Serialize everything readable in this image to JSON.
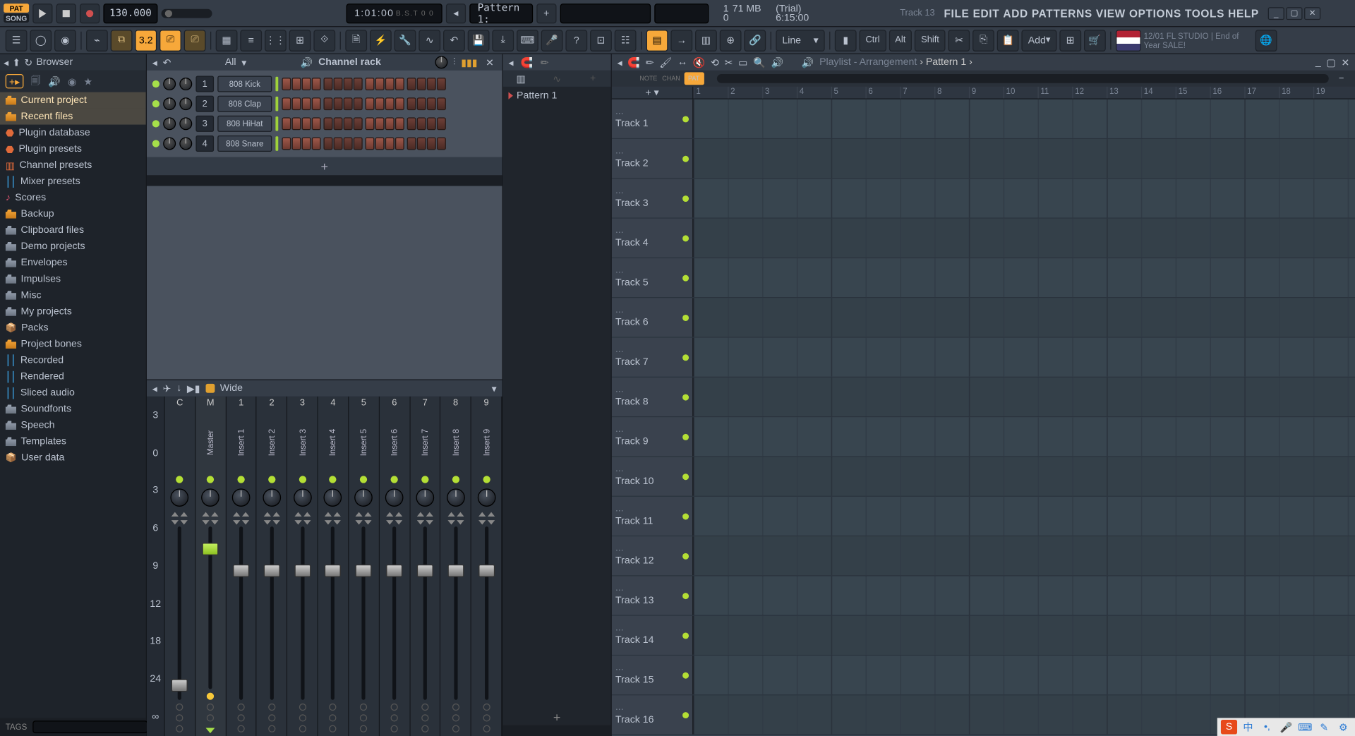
{
  "transport": {
    "patSong": {
      "pat": "PAT",
      "song": "SONG"
    },
    "tempo": "130.000",
    "time": "1:01:00",
    "timeSuffix": "B.S.T\n0 0",
    "patternSelector": "Pattern 1:",
    "cpu": "1",
    "cpuUnit": "",
    "mem": "71 MB",
    "mem2": "0",
    "trial": "(Trial)",
    "clock": "6:15:00",
    "trackHint": "Track 13",
    "news": "12/01  FL STUDIO | End of Year SALE!"
  },
  "menu": [
    "FILE",
    "EDIT",
    "ADD",
    "PATTERNS",
    "VIEW",
    "OPTIONS",
    "TOOLS",
    "HELP"
  ],
  "toolbar2": {
    "snap": "Line",
    "mods": [
      "Ctrl",
      "Alt",
      "Shift"
    ],
    "add": "Add",
    "numbered": "3.2"
  },
  "browser": {
    "title": "Browser",
    "items": [
      {
        "label": "Current project",
        "type": "hl"
      },
      {
        "label": "Recent files",
        "type": "hl"
      },
      {
        "label": "Plugin database",
        "icon": "plugin"
      },
      {
        "label": "Plugin presets",
        "icon": "plugin"
      },
      {
        "label": "Channel presets",
        "icon": "channel"
      },
      {
        "label": "Mixer presets",
        "icon": "mixer"
      },
      {
        "label": "Scores",
        "icon": "wave"
      },
      {
        "label": "Backup",
        "icon": "folderO"
      },
      {
        "label": "Clipboard files",
        "icon": "folder"
      },
      {
        "label": "Demo projects",
        "icon": "folder"
      },
      {
        "label": "Envelopes",
        "icon": "folder"
      },
      {
        "label": "Impulses",
        "icon": "folder"
      },
      {
        "label": "Misc",
        "icon": "folder"
      },
      {
        "label": "My projects",
        "icon": "folder"
      },
      {
        "label": "Packs",
        "icon": "packs"
      },
      {
        "label": "Project bones",
        "icon": "folderO"
      },
      {
        "label": "Recorded",
        "icon": "mixer"
      },
      {
        "label": "Rendered",
        "icon": "mixer"
      },
      {
        "label": "Sliced audio",
        "icon": "mixer"
      },
      {
        "label": "Soundfonts",
        "icon": "folder"
      },
      {
        "label": "Speech",
        "icon": "folder"
      },
      {
        "label": "Templates",
        "icon": "folder"
      },
      {
        "label": "User data",
        "icon": "packs"
      }
    ],
    "tags": "TAGS"
  },
  "channelRack": {
    "title": "Channel rack",
    "filter": "All",
    "channels": [
      {
        "num": "1",
        "name": "808 Kick"
      },
      {
        "num": "2",
        "name": "808 Clap"
      },
      {
        "num": "3",
        "name": "808 HiHat"
      },
      {
        "num": "4",
        "name": "808 Snare"
      }
    ]
  },
  "mixer": {
    "view": "Wide",
    "dbLabels": [
      "3",
      "0",
      "3",
      "6",
      "9",
      "12",
      "18",
      "24",
      "∞"
    ],
    "tracks": [
      {
        "label": "C",
        "name": "",
        "master": false,
        "fader": 88
      },
      {
        "label": "M",
        "name": "Master",
        "master": true,
        "fader": 10
      },
      {
        "label": "1",
        "name": "Insert 1",
        "fader": 22
      },
      {
        "label": "2",
        "name": "Insert 2",
        "fader": 22
      },
      {
        "label": "3",
        "name": "Insert 3",
        "fader": 22
      },
      {
        "label": "4",
        "name": "Insert 4",
        "fader": 22
      },
      {
        "label": "5",
        "name": "Insert 5",
        "fader": 22
      },
      {
        "label": "6",
        "name": "Insert 6",
        "fader": 22
      },
      {
        "label": "7",
        "name": "Insert 7",
        "fader": 22
      },
      {
        "label": "8",
        "name": "Insert 8",
        "fader": 22
      },
      {
        "label": "9",
        "name": "Insert 9",
        "fader": 22
      }
    ]
  },
  "patterns": {
    "items": [
      "Pattern 1"
    ]
  },
  "playlist": {
    "title": "Playlist - Arrangement",
    "crumb": "Pattern 1",
    "modes": [
      "NOTE",
      "CHAN",
      "PAT"
    ],
    "bars": [
      "1",
      "2",
      "3",
      "4",
      "5",
      "6",
      "7",
      "8",
      "9",
      "10",
      "11",
      "12",
      "13",
      "14",
      "15",
      "16",
      "17",
      "18",
      "19"
    ],
    "tracks": [
      "Track 1",
      "Track 2",
      "Track 3",
      "Track 4",
      "Track 5",
      "Track 6",
      "Track 7",
      "Track 8",
      "Track 9",
      "Track 10",
      "Track 11",
      "Track 12",
      "Track 13",
      "Track 14",
      "Track 15",
      "Track 16"
    ]
  }
}
